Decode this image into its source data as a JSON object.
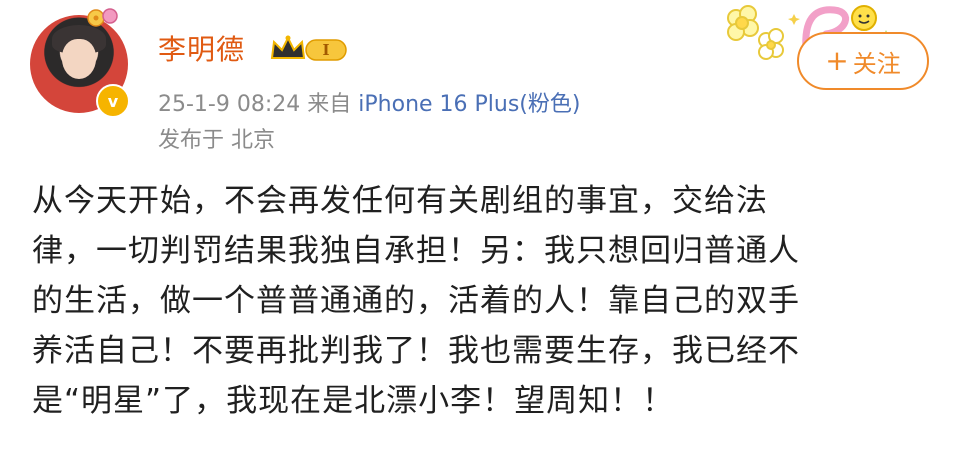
{
  "post": {
    "author": {
      "name": "李明德",
      "level_badge": "I",
      "verified_badge": "v",
      "avatar_icon": "user-avatar",
      "accent_color": "#e05a12"
    },
    "meta": {
      "time": "25-1-9 08:24",
      "source_prefix": "来自",
      "device": "iPhone 16 Plus(粉色)",
      "location": "发布于 北京"
    },
    "follow_button": {
      "icon": "+",
      "label": "关注",
      "color": "#f08a2a"
    },
    "content_lines": [
      "从今天开始，不会再发任何有关剧组的事宜，交给法",
      "律，一切判罚结果我独自承担！另：我只想回归普通人",
      "的生活，做一个普普通通的，活着的人！靠自己的双手",
      "养活自己！不要再批判我了！我也需要生存，我已经不",
      "是“明星”了，我现在是北漂小李！望周知！！"
    ]
  }
}
